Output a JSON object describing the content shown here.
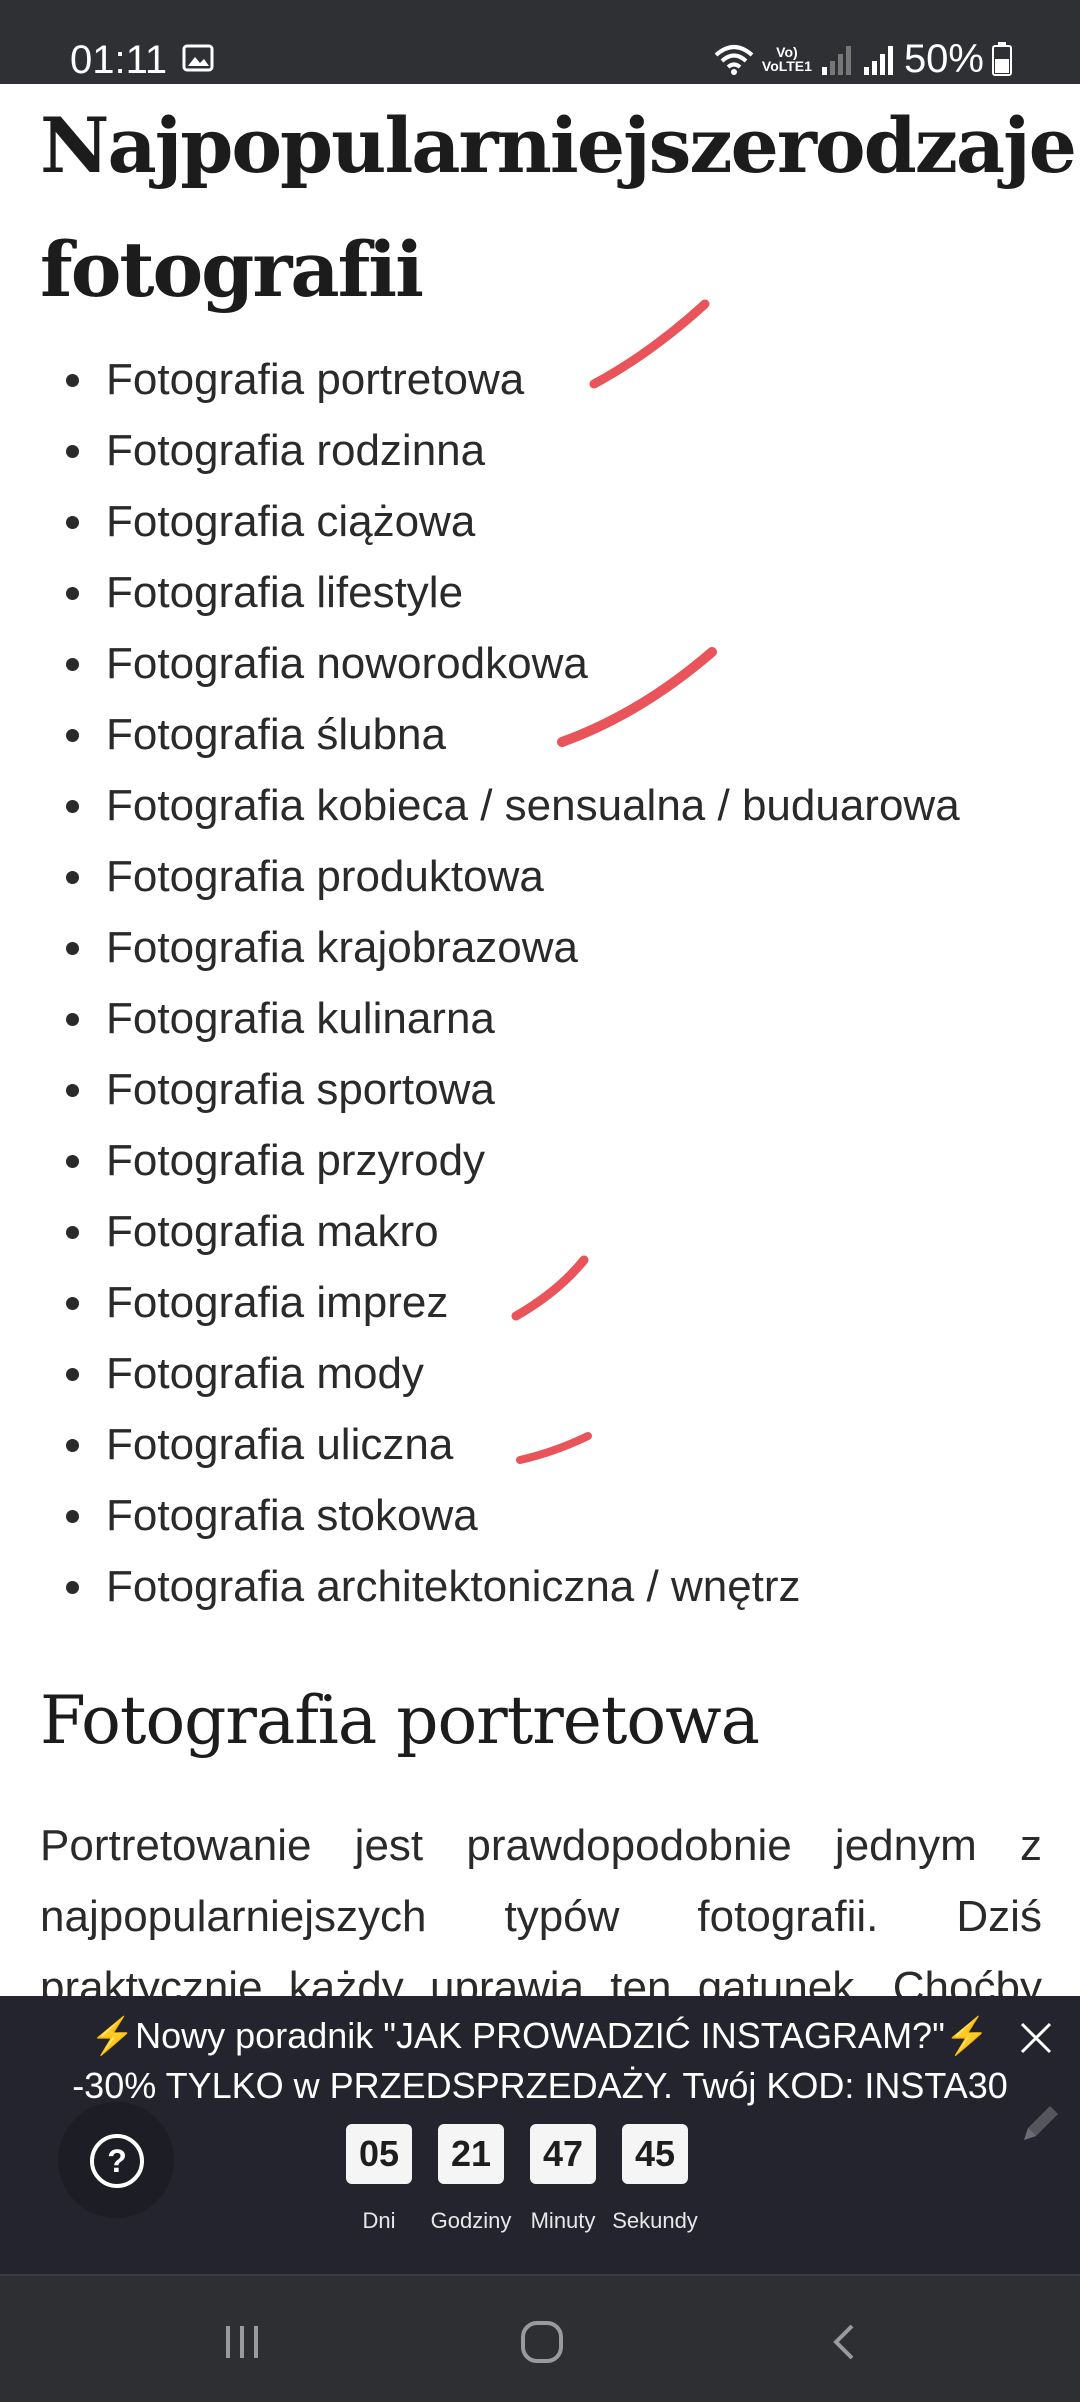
{
  "status_bar": {
    "time": "01:11",
    "network": "VoLTE1",
    "battery": "50%"
  },
  "article": {
    "title_line1_word1": "Najpopularniejsze",
    "title_line1_word2": "rodzaje",
    "title_line2": "fotografii",
    "list_items": [
      "Fotografia portretowa",
      "Fotografia rodzinna",
      "Fotografia ciążowa",
      "Fotografia lifestyle",
      "Fotografia noworodkowa",
      "Fotografia ślubna",
      "Fotografia kobieca / sensualna / buduarowa",
      "Fotografia produktowa",
      "Fotografia krajobrazowa",
      "Fotografia kulinarna",
      "Fotografia sportowa",
      "Fotografia przyrody",
      "Fotografia makro",
      "Fotografia imprez",
      "Fotografia mody",
      "Fotografia uliczna",
      "Fotografia stokowa",
      "Fotografia architektoniczna / wnętrz"
    ],
    "section_heading": "Fotografia portretowa",
    "paragraph_lines": [
      [
        "Portretowanie",
        "jest",
        "prawdopodobnie",
        "jednym",
        "z"
      ],
      [
        "najpopularniejszych",
        "typów",
        "fotografii.",
        "Dziś"
      ],
      [
        "praktycznie",
        "każdy",
        "uprawia",
        "ten",
        "gatunek.",
        "Choćby"
      ]
    ]
  },
  "promo": {
    "line1": "Nowy poradnik \"JAK PROWADZIĆ INSTAGRAM?\"",
    "bolt": "⚡",
    "line2": "-30% TYLKO w PRZEDSPRZEDAŻY. Twój KOD: INSTA30",
    "countdown": [
      {
        "value": "05",
        "label": "Dni"
      },
      {
        "value": "21",
        "label": "Godziny"
      },
      {
        "value": "47",
        "label": "Minuty"
      },
      {
        "value": "45",
        "label": "Sekundy"
      }
    ],
    "help_glyph": "?"
  },
  "colors": {
    "annotation_stroke": "#e8545a",
    "banner_bg": "#24242e",
    "status_bar_bg": "#2f3033"
  }
}
